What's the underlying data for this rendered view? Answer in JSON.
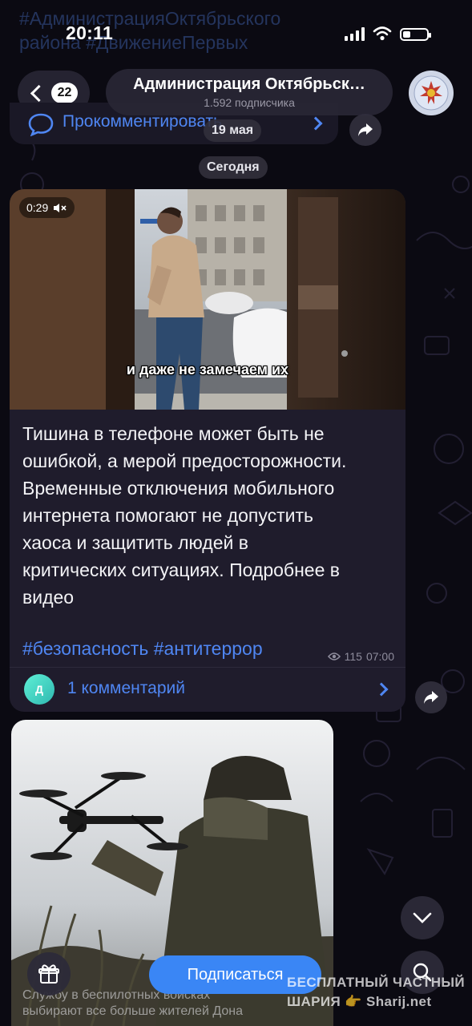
{
  "status_bar": {
    "time": "20:11"
  },
  "background_previous_post": {
    "hashtags_line": "#АдминистрацияОктябрьского района #ДвижениеПервых"
  },
  "header": {
    "back_count": "22",
    "channel_name": "Администрация Октябрьск…",
    "subscribers": "1.592 подписчика"
  },
  "previous_post": {
    "comment_label": "Прокомментировать",
    "date_badge": "19 мая"
  },
  "date_separator": "Сегодня",
  "post": {
    "video_duration": "0:29",
    "video_subtitle": "и даже не замечаем их",
    "text": "Тишина в телефоне может быть не\nошибкой, а мерой предосторожности.\nВременные отключения мобильного\nинтернета помогают не допустить\nхаоса и защитить людей в\nкритических ситуациях. Подробнее в\nвидео",
    "hashtags": "#безопасность #антитеррор",
    "views": "115",
    "time": "07:00",
    "comments_avatar_letter": "Д",
    "comments_label": "1 комментарий"
  },
  "next_post": {
    "caption": "Службу в беспилотных войсках\nвыбирают все больше жителей Дона"
  },
  "bottom_bar": {
    "subscribe_label": "Подписаться"
  },
  "watermark": {
    "line1": "БЕСПЛАТНЫЙ  ЧАСТНЫЙ",
    "line2": "ШАРИЯ 👉 Sharij.net"
  },
  "colors": {
    "accent": "#3a86f5",
    "link": "#4f86f2",
    "bubble": "#1f1c2c",
    "background": "#0b0a12"
  },
  "icons": [
    "back-chevron-icon",
    "signal-icon",
    "wifi-icon",
    "battery-icon",
    "comment-icon",
    "share-icon",
    "speaker-muted-icon",
    "eye-icon",
    "chevron-right-icon",
    "chevron-down-icon",
    "gift-icon",
    "search-icon"
  ]
}
